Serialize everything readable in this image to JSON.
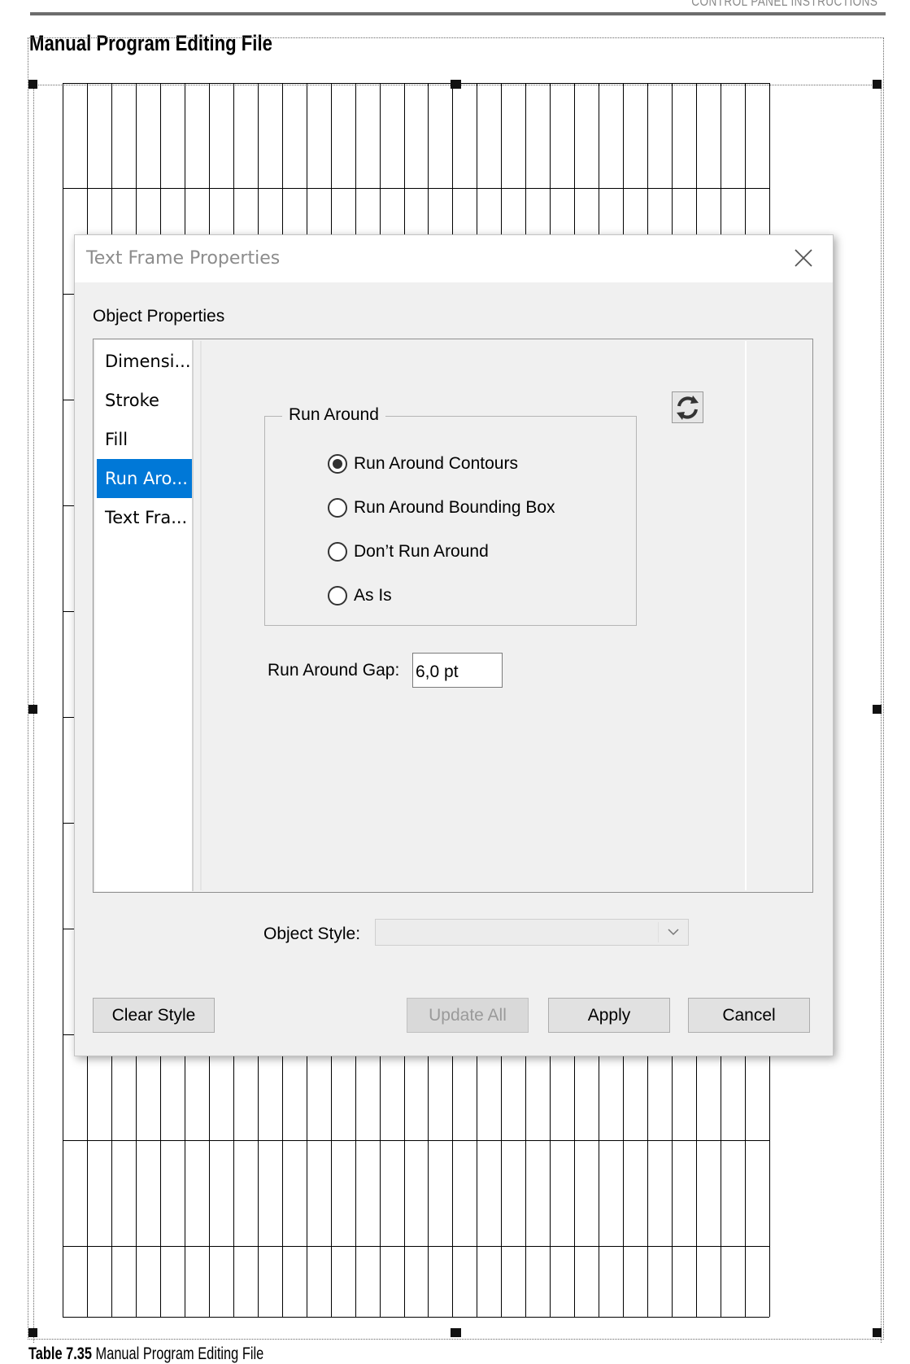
{
  "page": {
    "header": "CONTROL PANEL INSTRUCTIONS",
    "title": "Manual Program Editing File",
    "caption_label": "Table 7.35",
    "caption_text": "Manual Program Editing File"
  },
  "dialog": {
    "title": "Text Frame Properties",
    "close_icon": "close-icon",
    "section_label": "Object Properties",
    "sidebar": {
      "items": [
        {
          "label": "Dimensi...",
          "selected": false
        },
        {
          "label": "Stroke",
          "selected": false
        },
        {
          "label": "Fill",
          "selected": false
        },
        {
          "label": "Run Aro...",
          "selected": true
        },
        {
          "label": "Text Fra...",
          "selected": false
        }
      ]
    },
    "refresh_icon": "refresh-icon",
    "run_around": {
      "legend": "Run Around",
      "options": [
        {
          "label": "Run Around Contours",
          "checked": true
        },
        {
          "label": "Run Around Bounding Box",
          "checked": false
        },
        {
          "label": "Don’t Run Around",
          "checked": false
        },
        {
          "label": "As Is",
          "checked": false
        }
      ]
    },
    "gap": {
      "label": "Run Around Gap:",
      "value": "6,0 pt"
    },
    "object_style": {
      "label": "Object Style:",
      "value": ""
    },
    "buttons": {
      "clear_style": "Clear Style",
      "update_all": "Update All",
      "apply": "Apply",
      "cancel": "Cancel"
    },
    "colors": {
      "selection": "#0078d7",
      "dialog_bg": "#f0f0f0"
    }
  }
}
